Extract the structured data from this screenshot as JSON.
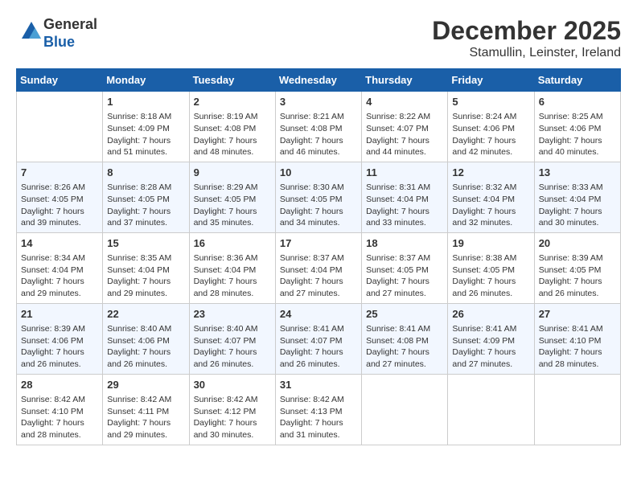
{
  "header": {
    "logo_line1": "General",
    "logo_line2": "Blue",
    "month_title": "December 2025",
    "subtitle": "Stamullin, Leinster, Ireland"
  },
  "days_of_week": [
    "Sunday",
    "Monday",
    "Tuesday",
    "Wednesday",
    "Thursday",
    "Friday",
    "Saturday"
  ],
  "weeks": [
    [
      {
        "day": "",
        "sunrise": "",
        "sunset": "",
        "daylight": ""
      },
      {
        "day": "1",
        "sunrise": "Sunrise: 8:18 AM",
        "sunset": "Sunset: 4:09 PM",
        "daylight": "Daylight: 7 hours and 51 minutes."
      },
      {
        "day": "2",
        "sunrise": "Sunrise: 8:19 AM",
        "sunset": "Sunset: 4:08 PM",
        "daylight": "Daylight: 7 hours and 48 minutes."
      },
      {
        "day": "3",
        "sunrise": "Sunrise: 8:21 AM",
        "sunset": "Sunset: 4:08 PM",
        "daylight": "Daylight: 7 hours and 46 minutes."
      },
      {
        "day": "4",
        "sunrise": "Sunrise: 8:22 AM",
        "sunset": "Sunset: 4:07 PM",
        "daylight": "Daylight: 7 hours and 44 minutes."
      },
      {
        "day": "5",
        "sunrise": "Sunrise: 8:24 AM",
        "sunset": "Sunset: 4:06 PM",
        "daylight": "Daylight: 7 hours and 42 minutes."
      },
      {
        "day": "6",
        "sunrise": "Sunrise: 8:25 AM",
        "sunset": "Sunset: 4:06 PM",
        "daylight": "Daylight: 7 hours and 40 minutes."
      }
    ],
    [
      {
        "day": "7",
        "sunrise": "Sunrise: 8:26 AM",
        "sunset": "Sunset: 4:05 PM",
        "daylight": "Daylight: 7 hours and 39 minutes."
      },
      {
        "day": "8",
        "sunrise": "Sunrise: 8:28 AM",
        "sunset": "Sunset: 4:05 PM",
        "daylight": "Daylight: 7 hours and 37 minutes."
      },
      {
        "day": "9",
        "sunrise": "Sunrise: 8:29 AM",
        "sunset": "Sunset: 4:05 PM",
        "daylight": "Daylight: 7 hours and 35 minutes."
      },
      {
        "day": "10",
        "sunrise": "Sunrise: 8:30 AM",
        "sunset": "Sunset: 4:05 PM",
        "daylight": "Daylight: 7 hours and 34 minutes."
      },
      {
        "day": "11",
        "sunrise": "Sunrise: 8:31 AM",
        "sunset": "Sunset: 4:04 PM",
        "daylight": "Daylight: 7 hours and 33 minutes."
      },
      {
        "day": "12",
        "sunrise": "Sunrise: 8:32 AM",
        "sunset": "Sunset: 4:04 PM",
        "daylight": "Daylight: 7 hours and 32 minutes."
      },
      {
        "day": "13",
        "sunrise": "Sunrise: 8:33 AM",
        "sunset": "Sunset: 4:04 PM",
        "daylight": "Daylight: 7 hours and 30 minutes."
      }
    ],
    [
      {
        "day": "14",
        "sunrise": "Sunrise: 8:34 AM",
        "sunset": "Sunset: 4:04 PM",
        "daylight": "Daylight: 7 hours and 29 minutes."
      },
      {
        "day": "15",
        "sunrise": "Sunrise: 8:35 AM",
        "sunset": "Sunset: 4:04 PM",
        "daylight": "Daylight: 7 hours and 29 minutes."
      },
      {
        "day": "16",
        "sunrise": "Sunrise: 8:36 AM",
        "sunset": "Sunset: 4:04 PM",
        "daylight": "Daylight: 7 hours and 28 minutes."
      },
      {
        "day": "17",
        "sunrise": "Sunrise: 8:37 AM",
        "sunset": "Sunset: 4:04 PM",
        "daylight": "Daylight: 7 hours and 27 minutes."
      },
      {
        "day": "18",
        "sunrise": "Sunrise: 8:37 AM",
        "sunset": "Sunset: 4:05 PM",
        "daylight": "Daylight: 7 hours and 27 minutes."
      },
      {
        "day": "19",
        "sunrise": "Sunrise: 8:38 AM",
        "sunset": "Sunset: 4:05 PM",
        "daylight": "Daylight: 7 hours and 26 minutes."
      },
      {
        "day": "20",
        "sunrise": "Sunrise: 8:39 AM",
        "sunset": "Sunset: 4:05 PM",
        "daylight": "Daylight: 7 hours and 26 minutes."
      }
    ],
    [
      {
        "day": "21",
        "sunrise": "Sunrise: 8:39 AM",
        "sunset": "Sunset: 4:06 PM",
        "daylight": "Daylight: 7 hours and 26 minutes."
      },
      {
        "day": "22",
        "sunrise": "Sunrise: 8:40 AM",
        "sunset": "Sunset: 4:06 PM",
        "daylight": "Daylight: 7 hours and 26 minutes."
      },
      {
        "day": "23",
        "sunrise": "Sunrise: 8:40 AM",
        "sunset": "Sunset: 4:07 PM",
        "daylight": "Daylight: 7 hours and 26 minutes."
      },
      {
        "day": "24",
        "sunrise": "Sunrise: 8:41 AM",
        "sunset": "Sunset: 4:07 PM",
        "daylight": "Daylight: 7 hours and 26 minutes."
      },
      {
        "day": "25",
        "sunrise": "Sunrise: 8:41 AM",
        "sunset": "Sunset: 4:08 PM",
        "daylight": "Daylight: 7 hours and 27 minutes."
      },
      {
        "day": "26",
        "sunrise": "Sunrise: 8:41 AM",
        "sunset": "Sunset: 4:09 PM",
        "daylight": "Daylight: 7 hours and 27 minutes."
      },
      {
        "day": "27",
        "sunrise": "Sunrise: 8:41 AM",
        "sunset": "Sunset: 4:10 PM",
        "daylight": "Daylight: 7 hours and 28 minutes."
      }
    ],
    [
      {
        "day": "28",
        "sunrise": "Sunrise: 8:42 AM",
        "sunset": "Sunset: 4:10 PM",
        "daylight": "Daylight: 7 hours and 28 minutes."
      },
      {
        "day": "29",
        "sunrise": "Sunrise: 8:42 AM",
        "sunset": "Sunset: 4:11 PM",
        "daylight": "Daylight: 7 hours and 29 minutes."
      },
      {
        "day": "30",
        "sunrise": "Sunrise: 8:42 AM",
        "sunset": "Sunset: 4:12 PM",
        "daylight": "Daylight: 7 hours and 30 minutes."
      },
      {
        "day": "31",
        "sunrise": "Sunrise: 8:42 AM",
        "sunset": "Sunset: 4:13 PM",
        "daylight": "Daylight: 7 hours and 31 minutes."
      },
      {
        "day": "",
        "sunrise": "",
        "sunset": "",
        "daylight": ""
      },
      {
        "day": "",
        "sunrise": "",
        "sunset": "",
        "daylight": ""
      },
      {
        "day": "",
        "sunrise": "",
        "sunset": "",
        "daylight": ""
      }
    ]
  ]
}
